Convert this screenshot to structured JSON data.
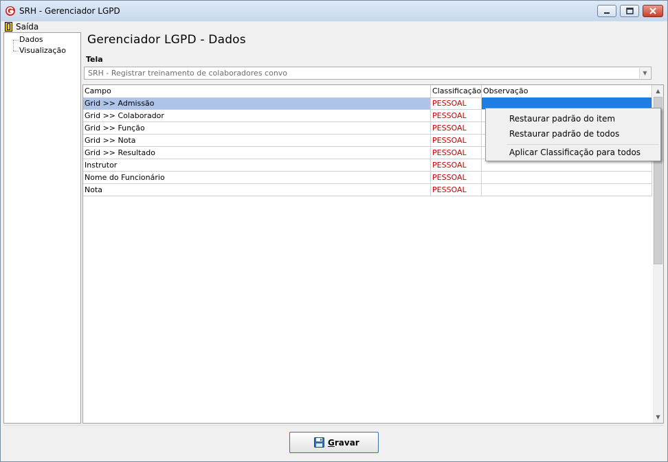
{
  "window": {
    "title": "SRH - Gerenciador LGPD",
    "app_icon": "srh-g-logo-icon"
  },
  "menu": {
    "exit_label": "Saída",
    "exit_icon": "exit-door-icon"
  },
  "nav": {
    "items": [
      {
        "label": "Dados"
      },
      {
        "label": "Visualização"
      }
    ]
  },
  "main": {
    "title": "Gerenciador LGPD - Dados",
    "tela_label": "Tela",
    "tela_value": "SRH - Registrar treinamento de colaboradores convo"
  },
  "grid": {
    "columns": [
      "Campo",
      "Classificação",
      "Observação"
    ],
    "rows": [
      {
        "campo": "Grid >> Admissão",
        "classificacao": "PESSOAL",
        "observacao": "",
        "selected": true
      },
      {
        "campo": "Grid >> Colaborador",
        "classificacao": "PESSOAL",
        "observacao": ""
      },
      {
        "campo": "Grid >> Função",
        "classificacao": "PESSOAL",
        "observacao": ""
      },
      {
        "campo": "Grid >> Nota",
        "classificacao": "PESSOAL",
        "observacao": ""
      },
      {
        "campo": "Grid >> Resultado",
        "classificacao": "PESSOAL",
        "observacao": ""
      },
      {
        "campo": "Instrutor",
        "classificacao": "PESSOAL",
        "observacao": ""
      },
      {
        "campo": "Nome do Funcionário",
        "classificacao": "PESSOAL",
        "observacao": ""
      },
      {
        "campo": "Nota",
        "classificacao": "PESSOAL",
        "observacao": ""
      }
    ]
  },
  "context_menu": {
    "items": [
      "Restaurar padrão do item",
      "Restaurar padrão de todos",
      "Aplicar Classificação para todos"
    ]
  },
  "footer": {
    "save_label_first": "G",
    "save_label_rest": "ravar",
    "save_icon": "floppy-disk-icon"
  },
  "colors": {
    "classification_text": "#cc0000",
    "selected_row": "#aec4e8",
    "selected_cell": "#1e7de3"
  }
}
